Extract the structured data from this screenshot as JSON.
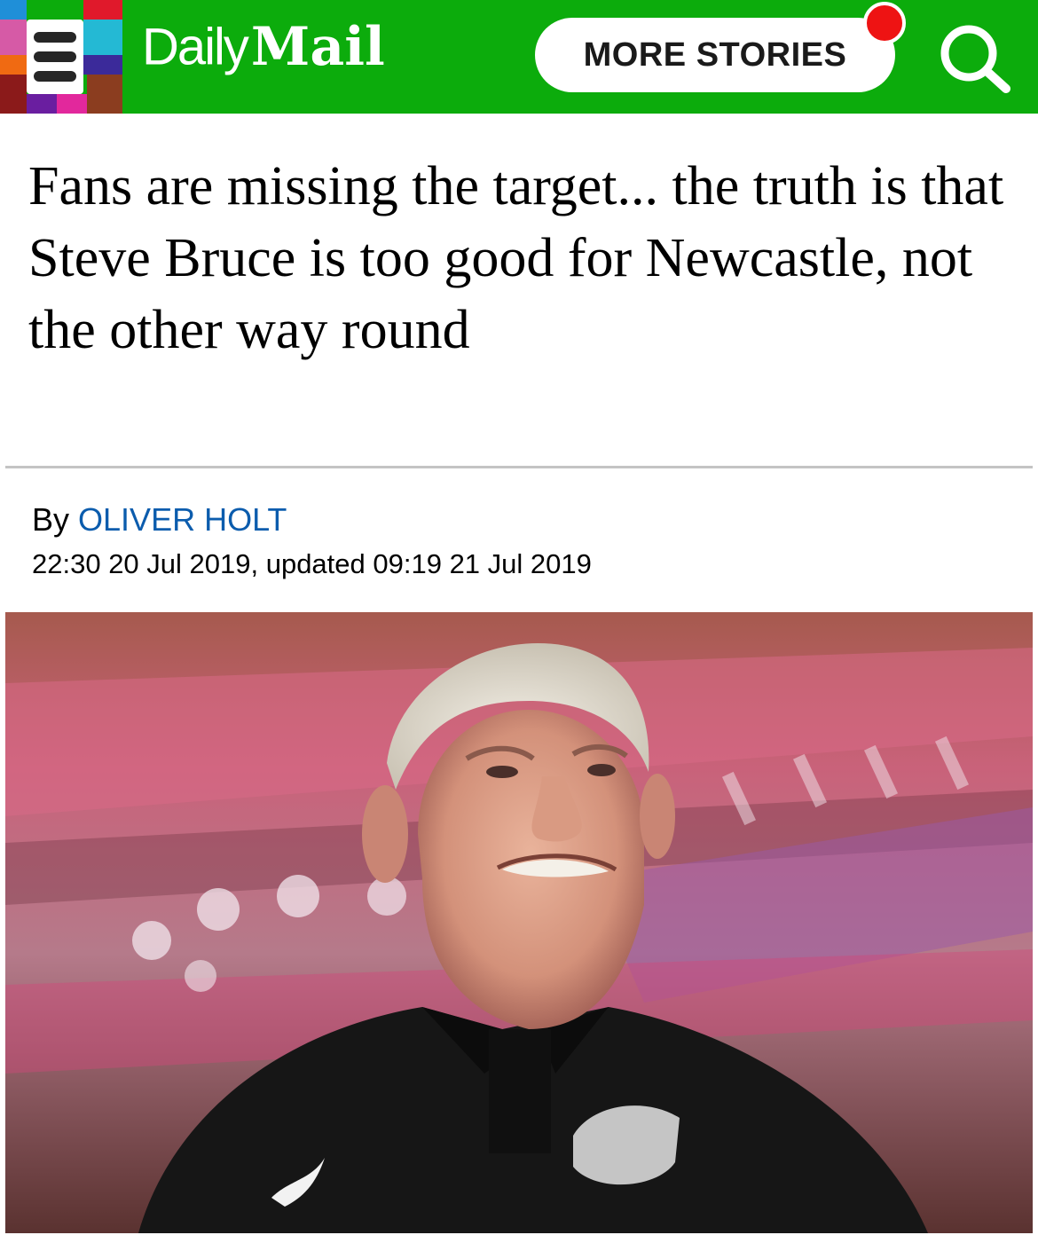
{
  "header": {
    "logo_daily": "Daily",
    "logo_mail": "Mail",
    "more_stories_label": "MORE STORIES",
    "icons": [
      "menu-icon",
      "search-icon",
      "notification-dot"
    ],
    "colors": {
      "bar": "#0cac0c",
      "notification": "#ee1313",
      "author_link": "#0b5cad"
    }
  },
  "article": {
    "headline": "Fans are missing the target... the truth is that Steve Bruce is too good for Newcastle, not the other way round",
    "byline_prefix": "By",
    "author": "OLIVER HOLT",
    "dateline": "22:30 20 Jul 2019, updated 09:19 21 Jul 2019"
  }
}
